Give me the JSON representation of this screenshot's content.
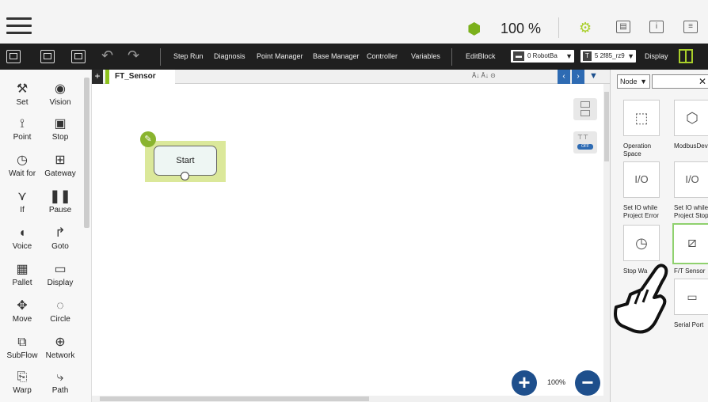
{
  "top_bar": {
    "speed": "100 %",
    "icons": [
      "menu-icon",
      "speed-icon",
      "robot-status-icon",
      "panel-icon",
      "info-icon",
      "screen-icon"
    ]
  },
  "toolbar": {
    "items": [
      "Step Run",
      "Diagnosis",
      "Point Manager",
      "Base Manager",
      "Controller",
      "Variables",
      "EditBlock"
    ],
    "base_select": {
      "prefix": "",
      "value": "0 RobotBa"
    },
    "tool_select": {
      "prefix": "T",
      "value": "5 2f85_rz9"
    },
    "display": "Display"
  },
  "left_panel": {
    "items": [
      {
        "label": "Set",
        "icon": "wrench-icon"
      },
      {
        "label": "Vision",
        "icon": "eye-icon"
      },
      {
        "label": "Point",
        "icon": "point-icon"
      },
      {
        "label": "Stop",
        "icon": "stop-icon"
      },
      {
        "label": "Wait for",
        "icon": "wait-icon"
      },
      {
        "label": "Gateway",
        "icon": "gateway-icon"
      },
      {
        "label": "If",
        "icon": "if-icon"
      },
      {
        "label": "Pause",
        "icon": "pause-icon"
      },
      {
        "label": "Voice",
        "icon": "voice-icon"
      },
      {
        "label": "Goto",
        "icon": "goto-icon"
      },
      {
        "label": "Pallet",
        "icon": "pallet-icon"
      },
      {
        "label": "Display",
        "icon": "display-icon"
      },
      {
        "label": "Move",
        "icon": "move-icon"
      },
      {
        "label": "Circle",
        "icon": "circle-icon"
      },
      {
        "label": "SubFlow",
        "icon": "subflow-icon"
      },
      {
        "label": "Network",
        "icon": "network-icon"
      },
      {
        "label": "Warp",
        "icon": "warp-icon"
      },
      {
        "label": "Path",
        "icon": "path-icon"
      }
    ]
  },
  "canvas": {
    "tab_title": "FT_Sensor",
    "tab_tools": "Ā↓ Ā↓ ⊙",
    "start_label": "Start",
    "zoom": "100%",
    "switch_label": "OFF"
  },
  "right_panel": {
    "select": "Node",
    "nodes": [
      {
        "label": "Operation Space",
        "icon": "operation-space-icon"
      },
      {
        "label": "ModbusDev",
        "icon": "modbus-icon"
      },
      {
        "label": "Set IO while Project Error",
        "icon": "io-error-icon"
      },
      {
        "label": "Set IO while Project Stop",
        "icon": "io-stop-icon"
      },
      {
        "label": "Stop Wa",
        "icon": "stopwatch-icon"
      },
      {
        "label": "F/T Sensor",
        "icon": "ft-sensor-icon"
      },
      {
        "label": "",
        "icon": "blank-icon"
      },
      {
        "label": "Serial Port",
        "icon": "serial-port-icon"
      }
    ]
  },
  "colors": {
    "accent_green": "#8fc31f",
    "blue": "#1e4f8c",
    "toolbar_bg": "#1f1f1f"
  }
}
